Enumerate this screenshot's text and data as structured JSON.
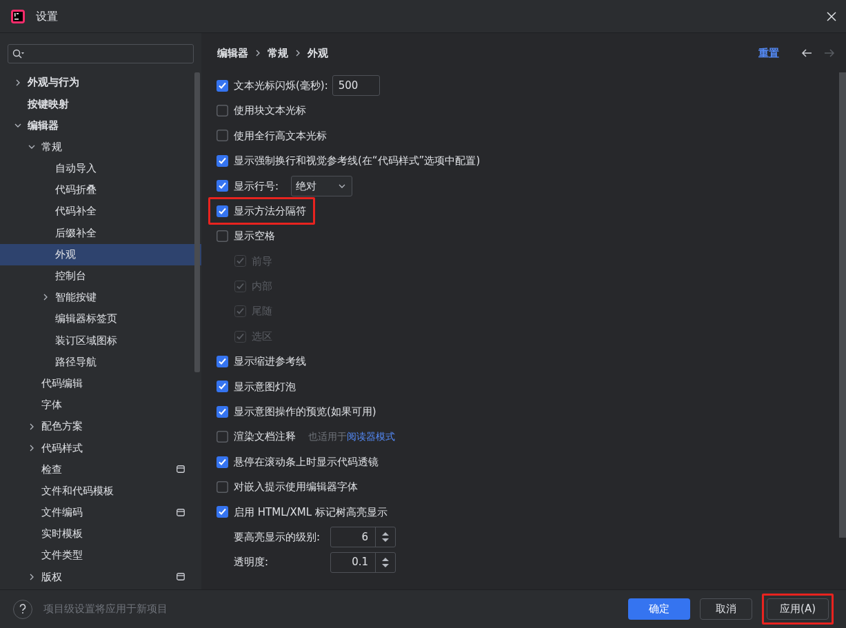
{
  "window": {
    "title": "设置"
  },
  "sidebar": {
    "items": [
      {
        "label": "外观与行为",
        "bold": true,
        "expanded": false,
        "has_children": true,
        "selected": false
      },
      {
        "label": "按键映射",
        "bold": true,
        "selected": false
      },
      {
        "label": "编辑器",
        "bold": true,
        "expanded": true,
        "has_children": true,
        "selected": false,
        "children": [
          {
            "label": "常规",
            "expanded": true,
            "has_children": true,
            "selected": false,
            "children": [
              {
                "label": "自动导入",
                "selected": false
              },
              {
                "label": "代码折叠",
                "selected": false
              },
              {
                "label": "代码补全",
                "selected": false
              },
              {
                "label": "后缀补全",
                "selected": false
              },
              {
                "label": "外观",
                "selected": true
              },
              {
                "label": "控制台",
                "selected": false
              },
              {
                "label": "智能按键",
                "expanded": false,
                "has_children": true,
                "selected": false
              },
              {
                "label": "编辑器标签页",
                "selected": false
              },
              {
                "label": "装订区域图标",
                "selected": false
              },
              {
                "label": "路径导航",
                "selected": false
              }
            ]
          },
          {
            "label": "代码编辑",
            "selected": false
          },
          {
            "label": "字体",
            "selected": false
          },
          {
            "label": "配色方案",
            "expanded": false,
            "has_children": true,
            "selected": false
          },
          {
            "label": "代码样式",
            "expanded": false,
            "has_children": true,
            "selected": false
          },
          {
            "label": "检查",
            "project_scope": true,
            "selected": false
          },
          {
            "label": "文件和代码模板",
            "selected": false
          },
          {
            "label": "文件编码",
            "project_scope": true,
            "selected": false
          },
          {
            "label": "实时模板",
            "selected": false
          },
          {
            "label": "文件类型",
            "selected": false
          },
          {
            "label": "版权",
            "expanded": false,
            "has_children": true,
            "project_scope": true,
            "selected": false
          }
        ]
      }
    ]
  },
  "breadcrumb": [
    "编辑器",
    "常规",
    "外观"
  ],
  "reset": "重置",
  "nav": {
    "back_enabled": true,
    "forward_enabled": false
  },
  "options": [
    {
      "kind": "checkbox",
      "label": "文本光标闪烁(毫秒):",
      "checked": true,
      "input": "500"
    },
    {
      "kind": "checkbox",
      "label": "使用块文本光标",
      "checked": false
    },
    {
      "kind": "checkbox",
      "label": "使用全行高文本光标",
      "checked": false
    },
    {
      "kind": "checkbox",
      "label": "显示强制换行和视觉参考线(在“代码样式”选项中配置)",
      "checked": true
    },
    {
      "kind": "checkbox",
      "label": "显示行号:",
      "checked": true,
      "select": "绝对"
    },
    {
      "kind": "checkbox",
      "label": "显示方法分隔符",
      "checked": true,
      "highlighted": true
    },
    {
      "kind": "checkbox",
      "label": "显示空格",
      "checked": false,
      "children": [
        {
          "kind": "checkbox",
          "label": "前导",
          "checked": true,
          "disabled": true
        },
        {
          "kind": "checkbox",
          "label": "内部",
          "checked": true,
          "disabled": true
        },
        {
          "kind": "checkbox",
          "label": "尾随",
          "checked": true,
          "disabled": true
        },
        {
          "kind": "checkbox",
          "label": "选区",
          "checked": true,
          "disabled": true
        }
      ]
    },
    {
      "kind": "checkbox",
      "label": "显示缩进参考线",
      "checked": true
    },
    {
      "kind": "checkbox",
      "label": "显示意图灯泡",
      "checked": true
    },
    {
      "kind": "checkbox",
      "label": "显示意图操作的预览(如果可用)",
      "checked": true
    },
    {
      "kind": "checkbox",
      "label": "渲染文档注释",
      "checked": false,
      "hint": "也适用于",
      "link": "阅读器模式"
    },
    {
      "kind": "checkbox",
      "label": "悬停在滚动条上时显示代码透镜",
      "checked": true
    },
    {
      "kind": "checkbox",
      "label": "对嵌入提示使用编辑器字体",
      "checked": false
    },
    {
      "kind": "checkbox",
      "label": "启用 HTML/XML 标记树高亮显示",
      "checked": true
    },
    {
      "kind": "spinner",
      "label": "要高亮显示的级别:",
      "value": "6"
    },
    {
      "kind": "spinner",
      "label": "透明度:",
      "value": "0.1"
    }
  ],
  "footer": {
    "help_text": "项目级设置将应用于新项目",
    "buttons": [
      {
        "label": "确定",
        "primary": true,
        "highlighted": false
      },
      {
        "label": "取消",
        "primary": false,
        "highlighted": false
      },
      {
        "label": "应用(A)",
        "primary": false,
        "highlighted": true
      }
    ]
  }
}
